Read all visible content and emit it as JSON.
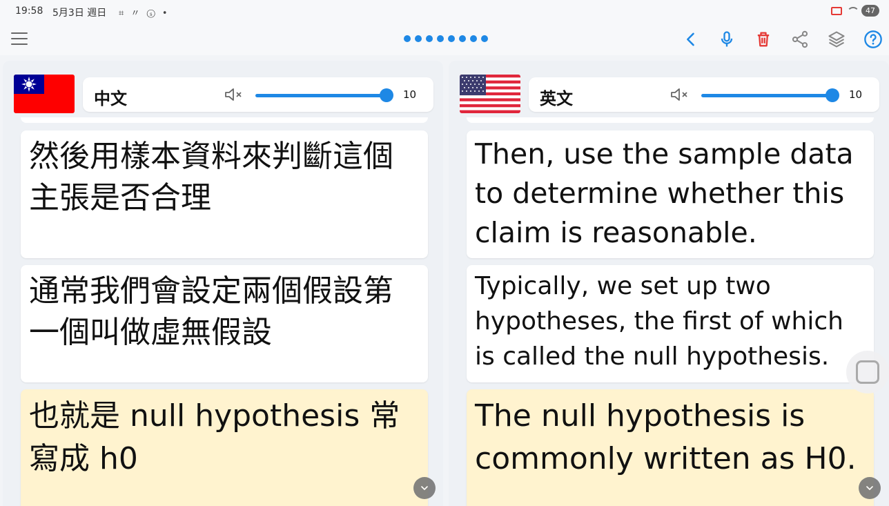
{
  "status_bar": {
    "time": "19:58",
    "date": "5月3日 週日",
    "notif_icons": "⌗ 〃 ⓢ •",
    "battery": "47"
  },
  "toolbar": {
    "page_dots": 8,
    "icons": [
      "menu-icon",
      "back-icon",
      "microphone-icon",
      "trash-icon",
      "share-icon",
      "layers-icon",
      "help-icon"
    ],
    "accent_color": "#1e88e5",
    "delete_color": "#e53935"
  },
  "left_panel": {
    "language": "中文",
    "volume": 10,
    "volume_level": 1.0,
    "cards": [
      {
        "text": "然後用樣本資料來判斷這個主張是否合理"
      },
      {
        "text": "通常我們會設定兩個假設第一個叫做虛無假設"
      },
      {
        "text": "也就是 null hypothesis 常寫成 h0"
      }
    ]
  },
  "right_panel": {
    "language": "英文",
    "volume": 10,
    "volume_level": 1.0,
    "cards": [
      {
        "text": "Then, use the sample data to determine whether this claim is reasonable."
      },
      {
        "text": "Typically, we set up two hypotheses, the first of which is called the null hypothesis."
      },
      {
        "text": "The null hypothesis is commonly written as H0."
      }
    ]
  },
  "colors": {
    "active_card": "#fff3cf",
    "card": "#ffffff",
    "panel_bg": "#eef1f5"
  }
}
